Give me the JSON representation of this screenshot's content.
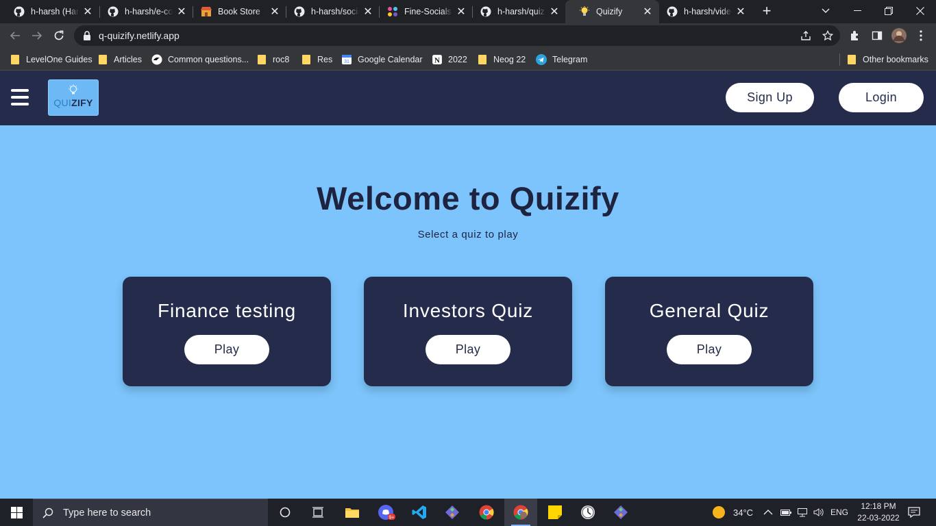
{
  "browser": {
    "tabs": [
      {
        "title": "h-harsh (Harsh",
        "icon": "github-icon",
        "active": false
      },
      {
        "title": "h-harsh/e-comm",
        "icon": "github-icon",
        "active": false
      },
      {
        "title": "Book Store",
        "icon": "store-icon",
        "active": false
      },
      {
        "title": "h-harsh/social",
        "icon": "github-icon",
        "active": false
      },
      {
        "title": "Fine-Socials",
        "icon": "dots-icon",
        "active": false
      },
      {
        "title": "h-harsh/quiz",
        "icon": "github-icon",
        "active": false
      },
      {
        "title": "Quizify",
        "icon": "bulb-icon",
        "active": true
      },
      {
        "title": "h-harsh/video",
        "icon": "github-icon",
        "active": false
      }
    ],
    "url": "q-quizify.netlify.app",
    "bookmarks": [
      {
        "label": "LevelOne Guides",
        "icon": "folder-icon"
      },
      {
        "label": "Articles",
        "icon": "folder-icon"
      },
      {
        "label": "Common questions...",
        "icon": "site-icon"
      },
      {
        "label": "roc8",
        "icon": "folder-icon"
      },
      {
        "label": "Res",
        "icon": "folder-icon"
      },
      {
        "label": "Google Calendar",
        "icon": "calendar-icon"
      },
      {
        "label": "2022",
        "icon": "notion-icon"
      },
      {
        "label": "Neog 22",
        "icon": "folder-icon"
      },
      {
        "label": "Telegram",
        "icon": "telegram-icon"
      }
    ],
    "other_bookmarks": "Other bookmarks"
  },
  "app": {
    "logo": {
      "part1": "QUI",
      "part2": "ZIFY"
    },
    "signup_label": "Sign Up",
    "login_label": "Login",
    "hero": {
      "title": "Welcome to Quizify",
      "subtitle": "Select a quiz to play"
    },
    "quizzes": [
      {
        "name": "Finance testing",
        "play_label": "Play"
      },
      {
        "name": "Investors Quiz",
        "play_label": "Play"
      },
      {
        "name": "General Quiz",
        "play_label": "Play"
      }
    ],
    "colors": {
      "navbar": "#252b4a",
      "background": "#7cc4fb",
      "card": "#252b4a",
      "button": "#ffffff"
    }
  },
  "taskbar": {
    "search_placeholder": "Type here to search",
    "weather": "34°C",
    "language": "ENG",
    "time": "12:18 PM",
    "date": "22-03-2022",
    "badge": "9+"
  }
}
